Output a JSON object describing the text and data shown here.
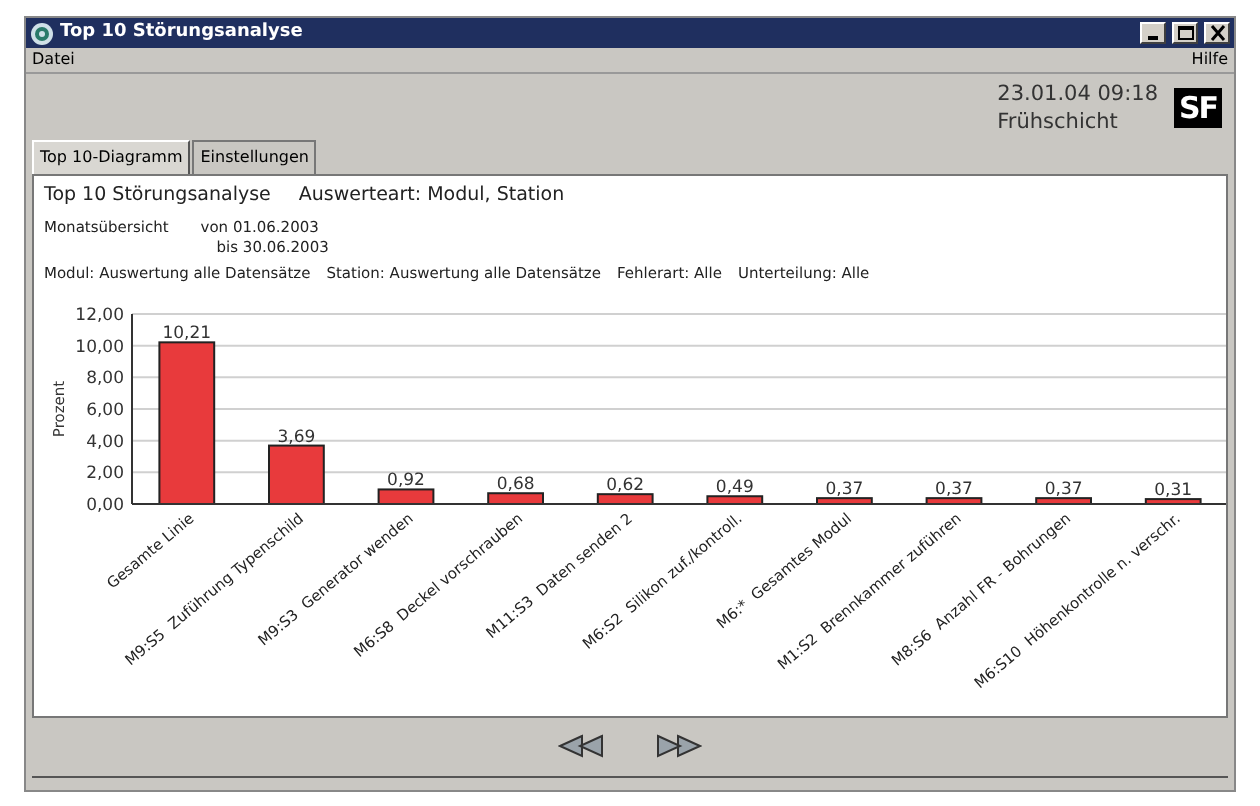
{
  "window": {
    "title": "Top 10 Störungsanalyse"
  },
  "menu": [
    {
      "label": "Datei"
    },
    {
      "label": "Hilfe"
    }
  ],
  "header": {
    "datetime": "23.01.04 09:18",
    "shift": "Frühschicht",
    "logo": "SF"
  },
  "tabs": [
    {
      "label": "Top 10-Diagramm",
      "selected": true
    },
    {
      "label": "Einstellungen",
      "selected": false
    }
  ],
  "report": {
    "title": "Top 10 Störungsanalyse",
    "mode": "Auswerteart: Modul, Station",
    "period_label": "Monatsübersicht",
    "from": "von 01.06.2003",
    "to": "bis 30.06.2003",
    "filters": [
      "Modul: Auswertung alle Datensätze",
      "Station: Auswertung alle Datensätze",
      "Fehlerart: Alle",
      "Unterteilung: Alle"
    ],
    "chart_data": {
      "type": "bar",
      "ylabel": "Prozent",
      "categories": [
        "Gesamte Linie",
        "M9:S5  Zuführung Typenschild",
        "M9:S3  Generator wenden",
        "M6:S8  Deckel vorschrauben",
        "M11:S3  Daten senden 2",
        "M6:S2  Silikon zuf./kontroll.",
        "M6:*  Gesamtes Modul",
        "M1:S2  Brennkammer zuführen",
        "M8:S6  Anzahl FR - Bohrungen",
        "M6:S10  Höhenkontrolle n. verschr."
      ],
      "grid": true,
      "series": [
        {
          "color": "#e83a3c",
          "values": [
            10.21,
            3.69,
            0.92,
            0.68,
            0.62,
            0.49,
            0.37,
            0.37,
            0.37,
            0.31
          ]
        }
      ],
      "value_labels": [
        "10,21",
        "3,69",
        "0,92",
        "0,68",
        "0,62",
        "0,49",
        "0,37",
        "0,37",
        "0,37",
        "0,31"
      ],
      "ylim": [
        0,
        12
      ],
      "yticks": [
        {
          "value": 0,
          "label": "0,00"
        },
        {
          "value": 2,
          "label": "2,00"
        },
        {
          "value": 4,
          "label": "4,00"
        },
        {
          "value": 6,
          "label": "6,00"
        },
        {
          "value": 8,
          "label": "8,00"
        },
        {
          "value": 10,
          "label": "10,00"
        },
        {
          "value": 12,
          "label": "12,00"
        }
      ]
    }
  },
  "navigation": [
    {
      "kind": "back"
    },
    {
      "kind": "forward"
    }
  ]
}
